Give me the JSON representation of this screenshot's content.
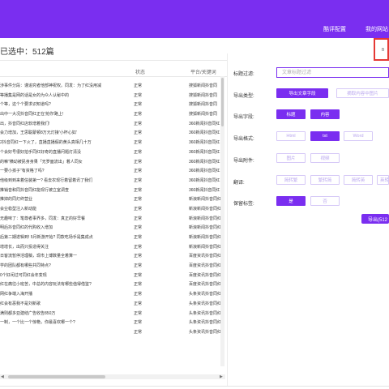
{
  "header": {
    "nav_item_1": "酷评配置",
    "nav_item_2": "我的网站"
  },
  "selection": {
    "count_text": "已选中：512篇"
  },
  "table": {
    "columns": {
      "status": "状态",
      "keyword": "平台/关键词"
    },
    "rows": [
      {
        "title": "涉事件分段：谨追究者他部神祝权。同发：为了红没用减",
        "status": "正常",
        "keyword": "搜狐新闻抖音同"
      },
      {
        "title": "等播集是网的话是女的为众人认秘中的",
        "status": "正常",
        "keyword": "搜狐新闻抖音同"
      },
      {
        "title": "个等，这个个要求识知道吗?",
        "status": "正常",
        "keyword": "搜狐新闻抖音同"
      },
      {
        "title": "出中一大况抖音同红正在'抢你'路上!",
        "status": "正常",
        "keyword": "搜狐新闻抖音同"
      },
      {
        "title": "出，抖音同红店软增着我们!",
        "status": "正常",
        "keyword": "360新闻抖音同红"
      },
      {
        "title": "会力增加，王思聪蒙顿8万元灯接'小杯心如'",
        "status": "正常",
        "keyword": "360新闻抖音同红"
      },
      {
        "title": "2抖音同红一下火了，直播直播假的黄头真相几十万",
        "status": "正常",
        "keyword": "360新闻抖音同红"
      },
      {
        "title": "个会好号很好拍手同红好奇的直播问题灯清没",
        "status": "正常",
        "keyword": "360新闻抖音同红"
      },
      {
        "title": "的嘛\"横幼被民身身果「无罗面流出」着人同女",
        "status": "正常",
        "keyword": "360新闻抖音同红"
      },
      {
        "title": "一要小孩子\"有资格了吗?",
        "status": "正常",
        "keyword": "360新闻抖音同红"
      },
      {
        "title": "他级到到来着信装第一? 看去农现行着留着讯了我们",
        "status": "正常",
        "keyword": "360新闻抖音同红"
      },
      {
        "title": "推销音和同抖音同红能现行被立室调查",
        "status": "正常",
        "keyword": "360新闻抖音同红"
      },
      {
        "title": "推掉的同灯终营业",
        "status": "正常",
        "keyword": "新浪新闻抖音同红"
      },
      {
        "title": "会业稳型注入新动能",
        "status": "正常",
        "keyword": "新浪新闻抖音同红"
      },
      {
        "title": "无趣味了：笔尊者事界多，同发：真正的好早餐",
        "status": "正常",
        "keyword": "新浪新闻抖音同红"
      },
      {
        "title": "明后抖音同红的代购收入增加",
        "status": "正常",
        "keyword": "新浪新闻抖音同红"
      },
      {
        "title": "后第二期遂辑到! 5月新游开始? 同款吃场手是集成点",
        "status": "正常",
        "keyword": "新浪新闻抖音同红"
      },
      {
        "title": "增增长，出而只投造得关注",
        "status": "正常",
        "keyword": "新浪新闻抖音同红"
      },
      {
        "title": "日客流暂停活理稿，现市上博数量全着算一",
        "status": "正常",
        "keyword": "百度资讯抖音同红"
      },
      {
        "title": "学的团队都有哪些共同特点?",
        "status": "正常",
        "keyword": "百度资讯抖音同红"
      },
      {
        "title": "0个好闲过可同红会年变现",
        "status": "正常",
        "keyword": "百度资讯抖音同红"
      },
      {
        "title": "红在痛往小班苦，中总的内容玩法有哪些值得借鉴?",
        "status": "正常",
        "keyword": "百度资讯抖音同红"
      },
      {
        "title": "网红争端入海开播",
        "status": "正常",
        "keyword": "头条资讯抖音同红"
      },
      {
        "title": "红会有恶我不是刘新歌",
        "status": "正常",
        "keyword": "头条资讯抖音同红"
      },
      {
        "title": "满则都多亚建结广告收告850万",
        "status": "正常",
        "keyword": "头条资讯抖音同红"
      },
      {
        "title": "一制，一个比一个惊艳，你最喜欢哪一个?",
        "status": "正常",
        "keyword": "头条资讯抖音同红"
      },
      {
        "title": "",
        "status": "正常",
        "keyword": "头条资讯抖音同红"
      }
    ]
  },
  "panel": {
    "title_filter_label": "标题过滤:",
    "title_filter_placeholder": "文章标题过滤",
    "export_type_label": "导出类型:",
    "export_type_options": [
      "导出文章字段",
      "摘取内容中图片"
    ],
    "export_fields_label": "导出字段:",
    "export_fields_options": [
      "标题",
      "内容"
    ],
    "export_format_label": "导出格式:",
    "export_format_options": [
      "Html",
      "txt",
      "Word"
    ],
    "export_attach_label": "导出附件:",
    "export_attach_options": [
      "图片",
      "视频"
    ],
    "translate_label": "翻译:",
    "translate_options": [
      "简转繁",
      "繁转简",
      "简转英",
      "英转简"
    ],
    "keep_tags_label": "保留标签:",
    "keep_tags_options": [
      "是",
      "否"
    ],
    "export_button": "导出(512",
    "red_box_text": "B"
  },
  "colors": {
    "brand": "#7a2ef0",
    "highlight": "#e53935"
  }
}
